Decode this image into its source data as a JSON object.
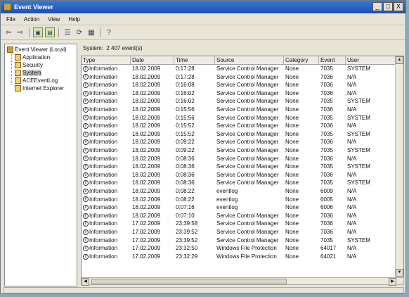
{
  "window": {
    "title": "Event Viewer",
    "minimize": "_",
    "maximize": "□",
    "close": "X"
  },
  "menu": [
    "File",
    "Action",
    "View",
    "Help"
  ],
  "toolbar": [
    {
      "icon": "back-arrow-icon",
      "glyph": "⇦"
    },
    {
      "icon": "forward-arrow-icon",
      "glyph": "⇨"
    },
    {
      "icon": "up-folder-icon",
      "glyph": "▣"
    },
    {
      "icon": "show-hide-tree-icon",
      "glyph": "▤"
    },
    {
      "icon": "properties-icon",
      "glyph": "☰"
    },
    {
      "icon": "refresh-icon",
      "glyph": "⟳"
    },
    {
      "icon": "export-list-icon",
      "glyph": "▦"
    },
    {
      "icon": "help-icon",
      "glyph": "?"
    }
  ],
  "tree": {
    "root": "Event Viewer (Local)",
    "items": [
      "Application",
      "Security",
      "System",
      "ACEEventLog",
      "Internet Explorer"
    ],
    "selected": "System"
  },
  "header": {
    "label": "System",
    "count": "2 407 event(s)"
  },
  "columns": [
    "Type",
    "Date",
    "Time",
    "Source",
    "Category",
    "Event",
    "User"
  ],
  "rows": [
    [
      "Information",
      "18.02.2009",
      "0:17:28",
      "Service Control Manager",
      "None",
      "7035",
      "SYSTEM"
    ],
    [
      "Information",
      "18.02.2009",
      "0:17:28",
      "Service Control Manager",
      "None",
      "7036",
      "N/A"
    ],
    [
      "Information",
      "18.02.2009",
      "0:16:08",
      "Service Control Manager",
      "None",
      "7036",
      "N/A"
    ],
    [
      "Information",
      "18.02.2009",
      "0:16:02",
      "Service Control Manager",
      "None",
      "7036",
      "N/A"
    ],
    [
      "Information",
      "18.02.2009",
      "0:16:02",
      "Service Control Manager",
      "None",
      "7035",
      "SYSTEM"
    ],
    [
      "Information",
      "18.02.2009",
      "0:15:56",
      "Service Control Manager",
      "None",
      "7036",
      "N/A"
    ],
    [
      "Information",
      "18.02.2009",
      "0:15:56",
      "Service Control Manager",
      "None",
      "7035",
      "SYSTEM"
    ],
    [
      "Information",
      "18.02.2009",
      "0:15:52",
      "Service Control Manager",
      "None",
      "7036",
      "N/A"
    ],
    [
      "Information",
      "18.02.2009",
      "0:15:52",
      "Service Control Manager",
      "None",
      "7035",
      "SYSTEM"
    ],
    [
      "Information",
      "18.02.2009",
      "0:09:22",
      "Service Control Manager",
      "None",
      "7036",
      "N/A"
    ],
    [
      "Information",
      "18.02.2009",
      "0:09:22",
      "Service Control Manager",
      "None",
      "7035",
      "SYSTEM"
    ],
    [
      "Information",
      "18.02.2009",
      "0:08:36",
      "Service Control Manager",
      "None",
      "7036",
      "N/A"
    ],
    [
      "Information",
      "18.02.2009",
      "0:08:36",
      "Service Control Manager",
      "None",
      "7035",
      "SYSTEM"
    ],
    [
      "Information",
      "18.02.2009",
      "0:08:36",
      "Service Control Manager",
      "None",
      "7036",
      "N/A"
    ],
    [
      "Information",
      "18.02.2009",
      "0:08:36",
      "Service Control Manager",
      "None",
      "7035",
      "SYSTEM"
    ],
    [
      "Information",
      "18.02.2009",
      "0:08:22",
      "eventlog",
      "None",
      "6009",
      "N/A"
    ],
    [
      "Information",
      "18.02.2009",
      "0:08:22",
      "eventlog",
      "None",
      "6005",
      "N/A"
    ],
    [
      "Information",
      "18.02.2009",
      "0:07:16",
      "eventlog",
      "None",
      "6006",
      "N/A"
    ],
    [
      "Information",
      "18.02.2009",
      "0:07:10",
      "Service Control Manager",
      "None",
      "7036",
      "N/A"
    ],
    [
      "Information",
      "17.02.2009",
      "23:39:58",
      "Service Control Manager",
      "None",
      "7036",
      "N/A"
    ],
    [
      "Information",
      "17.02.2009",
      "23:39:52",
      "Service Control Manager",
      "None",
      "7036",
      "N/A"
    ],
    [
      "Information",
      "17.02.2009",
      "23:39:52",
      "Service Control Manager",
      "None",
      "7035",
      "SYSTEM"
    ],
    [
      "Information",
      "17.02.2009",
      "23:32:50",
      "Windows File Protection",
      "None",
      "64017",
      "N/A"
    ],
    [
      "Information",
      "17.02.2009",
      "23:32:29",
      "Windows File Protection",
      "None",
      "64021",
      "N/A"
    ]
  ],
  "colors": {
    "titlebar": "#1e4fb0",
    "window_bg": "#e8e4d8",
    "tree_icon": "#f4d070"
  }
}
